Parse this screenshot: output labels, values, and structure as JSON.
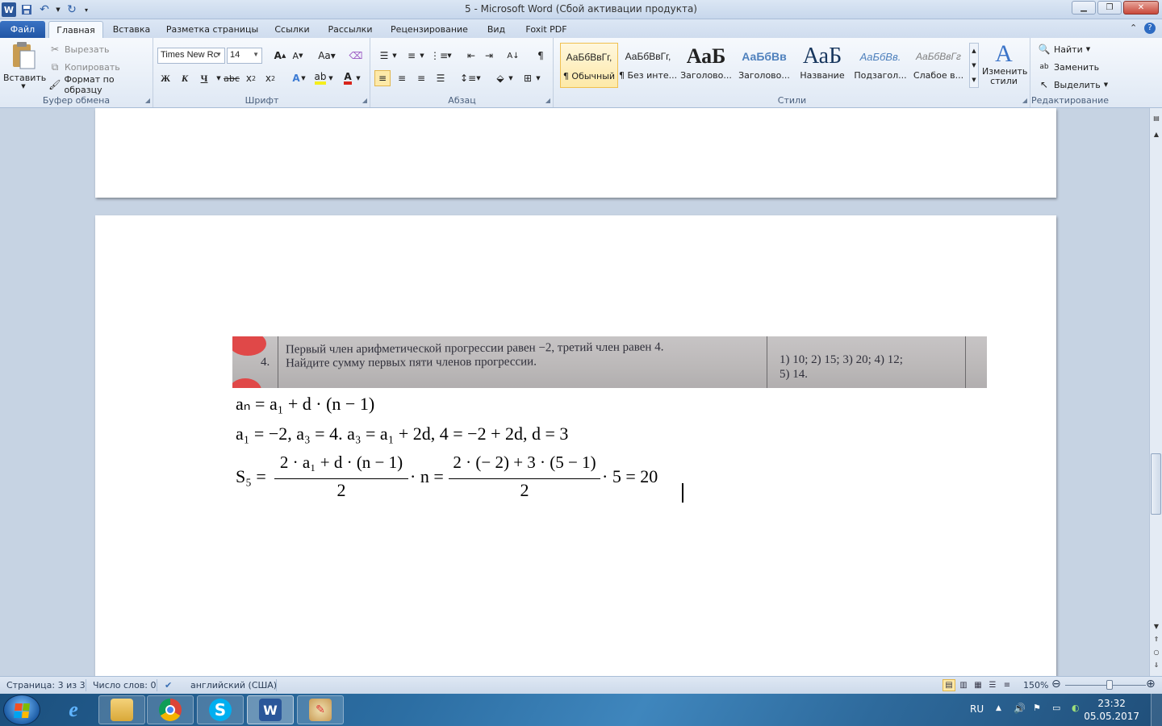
{
  "window": {
    "title": "5 - Microsoft Word (Сбой активации продукта)",
    "qat_icons": [
      "word-icon",
      "save-icon",
      "undo-icon",
      "redo-icon",
      "customize-icon"
    ]
  },
  "tabs": {
    "file": "Файл",
    "items": [
      "Главная",
      "Вставка",
      "Разметка страницы",
      "Ссылки",
      "Рассылки",
      "Рецензирование",
      "Вид",
      "Foxit PDF"
    ],
    "active": "Главная"
  },
  "ribbon": {
    "clipboard": {
      "paste": "Вставить",
      "cut": "Вырезать",
      "copy": "Копировать",
      "format_painter": "Формат по образцу",
      "label": "Буфер обмена"
    },
    "font": {
      "font_name": "Times New Rc",
      "font_size": "14",
      "label": "Шрифт"
    },
    "paragraph": {
      "label": "Абзац"
    },
    "styles": {
      "items": [
        {
          "sample": "АаБбВвГг,",
          "name": "¶ Обычный"
        },
        {
          "sample": "АаБбВвГг,",
          "name": "¶ Без инте..."
        },
        {
          "sample": "АаБ",
          "name": "Заголово..."
        },
        {
          "sample": "АаБбВв",
          "name": "Заголово..."
        },
        {
          "sample": "АаБ",
          "name": "Название"
        },
        {
          "sample": "АаБбВв.",
          "name": "Подзагол..."
        },
        {
          "sample": "АаБбВвГг",
          "name": "Слабое в..."
        }
      ],
      "change_styles": "Изменить стили",
      "label": "Стили"
    },
    "editing": {
      "find": "Найти",
      "replace": "Заменить",
      "select": "Выделить",
      "label": "Редактирование"
    }
  },
  "document": {
    "photo": {
      "number": "4.",
      "question_line1": "Первый член арифметической прогрессии равен  −2, третий член равен 4.",
      "question_line2": "Найдите сумму первых пяти членов прогрессии.",
      "answers_line1": "1) 10;   2) 15;   3) 20;   4) 12;",
      "answers_line2": "5) 14."
    },
    "eq1": "aₙ = a₁ + d · (n − 1)",
    "eq2": "a₁ = −2,    a₃ = 4.    a₃ = a₁ + 2d,    4 = −2 + 2d,    d = 3",
    "eq3": {
      "lhs": "S₅ =",
      "num1": "2 · a₁ + d · (n − 1)",
      "den1": "2",
      "mid": "· n =",
      "num2": "2 · (− 2) + 3 · (5 − 1)",
      "den2": "2",
      "rhs": "· 5 = 20"
    }
  },
  "statusbar": {
    "page": "Страница: 3 из 3",
    "words": "Число слов: 0",
    "language": "английский (США)",
    "zoom": "150%",
    "zoom_level": 0.5
  },
  "taskbar": {
    "apps": [
      "ie-icon",
      "explorer-icon",
      "chrome-icon",
      "skype-icon",
      "word-icon",
      "paint-icon"
    ],
    "lang": "RU",
    "time": "23:32",
    "date": "05.05.2017"
  },
  "colors": {
    "ribbon_bg": "#dfe8f4",
    "file_tab": "#2b5fa8",
    "doc_bg": "#c6d3e3",
    "taskbar": "#2c6ea3"
  }
}
